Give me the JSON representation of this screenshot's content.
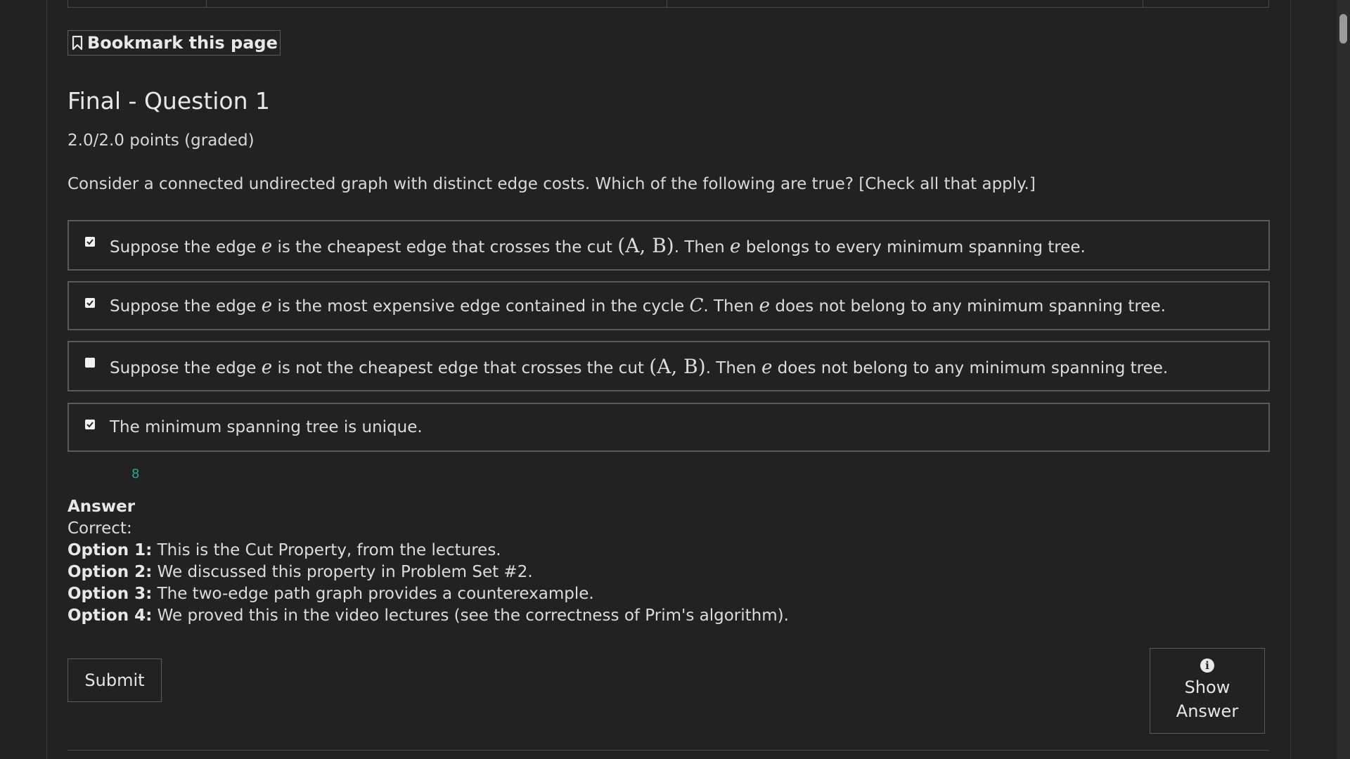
{
  "bookmark": {
    "label": "Bookmark this page"
  },
  "problem": {
    "title": "Final - Question 1",
    "points": "2.0/2.0 points (graded)",
    "prompt": "Consider a connected undirected graph with distinct edge costs. Which of the following are true? [Check all that apply.]"
  },
  "options": [
    {
      "checked": true,
      "parts": {
        "a": "Suppose the edge ",
        "e1": "e",
        "b": " is the cheapest edge that crosses the cut ",
        "m": "(A, B)",
        "c": ". Then ",
        "e2": "e",
        "d": " belongs to every minimum spanning tree."
      }
    },
    {
      "checked": true,
      "parts": {
        "a": "Suppose the edge ",
        "e1": "e",
        "b": " is the most expensive edge contained in the cycle ",
        "m": "C",
        "c": ". Then ",
        "e2": "e",
        "d": " does not belong to any minimum spanning tree."
      }
    },
    {
      "checked": false,
      "parts": {
        "a": "Suppose the edge ",
        "e1": "e",
        "b": " is not the cheapest edge that crosses the cut ",
        "m": "(A, B)",
        "c": ". Then ",
        "e2": "e",
        "d": " does not belong to any minimum spanning tree."
      }
    },
    {
      "checked": true,
      "text": "The minimum spanning tree is unique."
    }
  ],
  "score_badge": "8",
  "answer": {
    "heading": "Answer",
    "correct_label": "Correct:",
    "items": [
      {
        "label": "Option 1:",
        "text": " This is the Cut Property, from the lectures."
      },
      {
        "label": "Option 2:",
        "text": " We discussed this property in Problem Set #2."
      },
      {
        "label": "Option 3:",
        "text": " The two-edge path graph provides a counterexample."
      },
      {
        "label": "Option 4:",
        "text": " We proved this in the video lectures (see the correctness of Prim's algorithm)."
      }
    ]
  },
  "actions": {
    "submit_label": "Submit",
    "show_answer_line1": "Show",
    "show_answer_line2": "Answer",
    "info_icon_glyph": "i"
  },
  "colors": {
    "background": "#222222",
    "score_color": "#2aa69a"
  }
}
